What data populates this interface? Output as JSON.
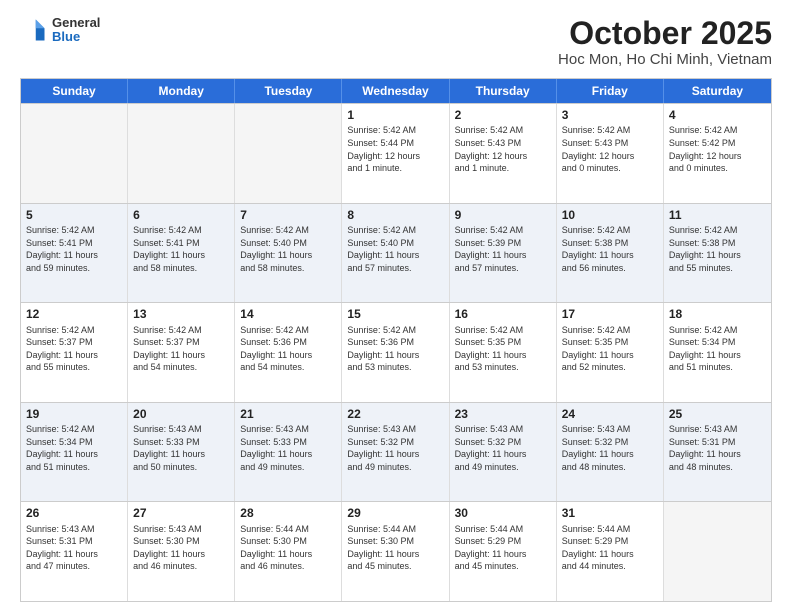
{
  "logo": {
    "general": "General",
    "blue": "Blue"
  },
  "title": {
    "month": "October 2025",
    "location": "Hoc Mon, Ho Chi Minh, Vietnam"
  },
  "header_days": [
    "Sunday",
    "Monday",
    "Tuesday",
    "Wednesday",
    "Thursday",
    "Friday",
    "Saturday"
  ],
  "weeks": [
    [
      {
        "day": "",
        "info": "",
        "empty": true
      },
      {
        "day": "",
        "info": "",
        "empty": true
      },
      {
        "day": "",
        "info": "",
        "empty": true
      },
      {
        "day": "1",
        "info": "Sunrise: 5:42 AM\nSunset: 5:44 PM\nDaylight: 12 hours\nand 1 minute."
      },
      {
        "day": "2",
        "info": "Sunrise: 5:42 AM\nSunset: 5:43 PM\nDaylight: 12 hours\nand 1 minute."
      },
      {
        "day": "3",
        "info": "Sunrise: 5:42 AM\nSunset: 5:43 PM\nDaylight: 12 hours\nand 0 minutes."
      },
      {
        "day": "4",
        "info": "Sunrise: 5:42 AM\nSunset: 5:42 PM\nDaylight: 12 hours\nand 0 minutes."
      }
    ],
    [
      {
        "day": "5",
        "info": "Sunrise: 5:42 AM\nSunset: 5:41 PM\nDaylight: 11 hours\nand 59 minutes."
      },
      {
        "day": "6",
        "info": "Sunrise: 5:42 AM\nSunset: 5:41 PM\nDaylight: 11 hours\nand 58 minutes."
      },
      {
        "day": "7",
        "info": "Sunrise: 5:42 AM\nSunset: 5:40 PM\nDaylight: 11 hours\nand 58 minutes."
      },
      {
        "day": "8",
        "info": "Sunrise: 5:42 AM\nSunset: 5:40 PM\nDaylight: 11 hours\nand 57 minutes."
      },
      {
        "day": "9",
        "info": "Sunrise: 5:42 AM\nSunset: 5:39 PM\nDaylight: 11 hours\nand 57 minutes."
      },
      {
        "day": "10",
        "info": "Sunrise: 5:42 AM\nSunset: 5:38 PM\nDaylight: 11 hours\nand 56 minutes."
      },
      {
        "day": "11",
        "info": "Sunrise: 5:42 AM\nSunset: 5:38 PM\nDaylight: 11 hours\nand 55 minutes."
      }
    ],
    [
      {
        "day": "12",
        "info": "Sunrise: 5:42 AM\nSunset: 5:37 PM\nDaylight: 11 hours\nand 55 minutes."
      },
      {
        "day": "13",
        "info": "Sunrise: 5:42 AM\nSunset: 5:37 PM\nDaylight: 11 hours\nand 54 minutes."
      },
      {
        "day": "14",
        "info": "Sunrise: 5:42 AM\nSunset: 5:36 PM\nDaylight: 11 hours\nand 54 minutes."
      },
      {
        "day": "15",
        "info": "Sunrise: 5:42 AM\nSunset: 5:36 PM\nDaylight: 11 hours\nand 53 minutes."
      },
      {
        "day": "16",
        "info": "Sunrise: 5:42 AM\nSunset: 5:35 PM\nDaylight: 11 hours\nand 53 minutes."
      },
      {
        "day": "17",
        "info": "Sunrise: 5:42 AM\nSunset: 5:35 PM\nDaylight: 11 hours\nand 52 minutes."
      },
      {
        "day": "18",
        "info": "Sunrise: 5:42 AM\nSunset: 5:34 PM\nDaylight: 11 hours\nand 51 minutes."
      }
    ],
    [
      {
        "day": "19",
        "info": "Sunrise: 5:42 AM\nSunset: 5:34 PM\nDaylight: 11 hours\nand 51 minutes."
      },
      {
        "day": "20",
        "info": "Sunrise: 5:43 AM\nSunset: 5:33 PM\nDaylight: 11 hours\nand 50 minutes."
      },
      {
        "day": "21",
        "info": "Sunrise: 5:43 AM\nSunset: 5:33 PM\nDaylight: 11 hours\nand 49 minutes."
      },
      {
        "day": "22",
        "info": "Sunrise: 5:43 AM\nSunset: 5:32 PM\nDaylight: 11 hours\nand 49 minutes."
      },
      {
        "day": "23",
        "info": "Sunrise: 5:43 AM\nSunset: 5:32 PM\nDaylight: 11 hours\nand 49 minutes."
      },
      {
        "day": "24",
        "info": "Sunrise: 5:43 AM\nSunset: 5:32 PM\nDaylight: 11 hours\nand 48 minutes."
      },
      {
        "day": "25",
        "info": "Sunrise: 5:43 AM\nSunset: 5:31 PM\nDaylight: 11 hours\nand 48 minutes."
      }
    ],
    [
      {
        "day": "26",
        "info": "Sunrise: 5:43 AM\nSunset: 5:31 PM\nDaylight: 11 hours\nand 47 minutes."
      },
      {
        "day": "27",
        "info": "Sunrise: 5:43 AM\nSunset: 5:30 PM\nDaylight: 11 hours\nand 46 minutes."
      },
      {
        "day": "28",
        "info": "Sunrise: 5:44 AM\nSunset: 5:30 PM\nDaylight: 11 hours\nand 46 minutes."
      },
      {
        "day": "29",
        "info": "Sunrise: 5:44 AM\nSunset: 5:30 PM\nDaylight: 11 hours\nand 45 minutes."
      },
      {
        "day": "30",
        "info": "Sunrise: 5:44 AM\nSunset: 5:29 PM\nDaylight: 11 hours\nand 45 minutes."
      },
      {
        "day": "31",
        "info": "Sunrise: 5:44 AM\nSunset: 5:29 PM\nDaylight: 11 hours\nand 44 minutes."
      },
      {
        "day": "",
        "info": "",
        "empty": true
      }
    ]
  ],
  "colors": {
    "header_bg": "#2a6dd9",
    "alt_row_bg": "#eef2f8"
  }
}
